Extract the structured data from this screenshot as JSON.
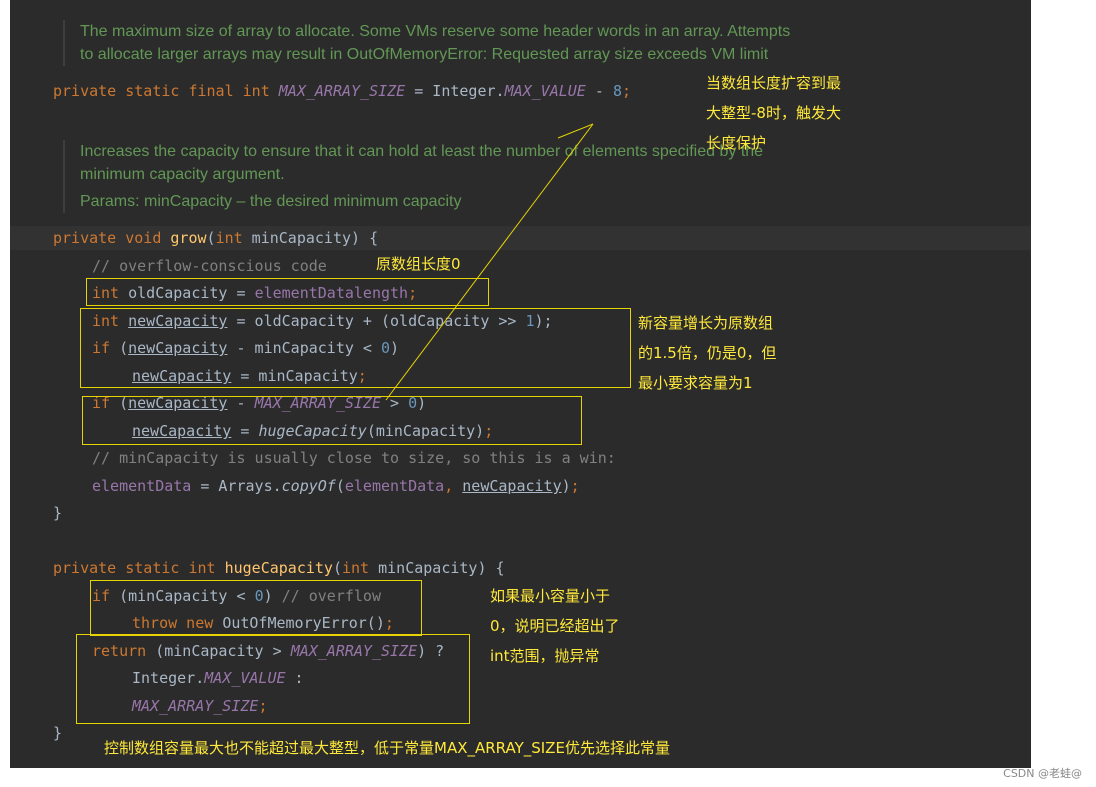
{
  "doc_comments": {
    "max_array_size": [
      "The maximum size of array to allocate. Some VMs reserve some header words in an array. Attempts",
      "to allocate larger arrays may result in OutOfMemoryError: Requested array size exceeds VM limit"
    ],
    "grow": [
      "Increases the capacity to ensure that it can hold at least the number of elements specified by the",
      "minimum capacity argument.",
      "Params: minCapacity – the desired minimum capacity"
    ]
  },
  "code": {
    "l1": {
      "a": "private static final int ",
      "b": "MAX_ARRAY_SIZE",
      "c": " = Integer.",
      "d": "MAX_VALUE",
      "e": " - ",
      "f": "8",
      ";": ";"
    },
    "l2": {
      "a": "private void ",
      "b": "grow",
      "c": "(",
      "d": "int",
      " e": "",
      "f": " minCapacity) {"
    },
    "l3": "// overflow-conscious code",
    "l4": {
      "a": "int",
      " b": "",
      "c": " oldCapacity = ",
      "d": "elementData",
      ".": ".",
      "e": "length",
      ";": ";"
    },
    "l5": {
      "a": "int ",
      "b": "newCapacity",
      "c": " = oldCapacity + (oldCapacity >> ",
      "d": "1",
      "e": ");"
    },
    "l6": {
      "a": "if",
      " b": "",
      "c": " (",
      "d": "newCapacity",
      "e": " - minCapacity < ",
      "f": "0",
      "g": ")"
    },
    "l7": {
      "a": "newCapacity",
      "b": " = minCapacity",
      ";": ";"
    },
    "l8": {
      "a": "if",
      "c": " (",
      "d": "newCapacity",
      "e": " - ",
      "f": "MAX_ARRAY_SIZE",
      "g": " > ",
      "h": "0",
      "i": ")"
    },
    "l9": {
      "a": "newCapacity",
      "b": " = ",
      "c": "hugeCapacity",
      "d": "(minCapacity)",
      ";": ";"
    },
    "l10": "// minCapacity is usually close to size, so this is a win:",
    "l11": {
      "a": "elementData",
      "b": " = Arrays.",
      "c": "copyOf",
      "d": "(",
      "e": "elementData",
      ",": ", ",
      "f": "newCapacity",
      "g": ")",
      ";": ";"
    },
    "l12": "}",
    "l13": {
      "a": "private static int ",
      "b": "hugeCapacity",
      "c": "(",
      "d": "int",
      "e": " minCapacity) {"
    },
    "l14": {
      "a": "if",
      "b": " (minCapacity < ",
      "c": "0",
      "d": ") ",
      "e": "// overflow"
    },
    "l15": {
      "a": "throw new ",
      "b": "OutOfMemoryError()",
      ";": ";"
    },
    "l16": {
      "a": "return",
      " b": "",
      "c": " (minCapacity > ",
      "d": "MAX_ARRAY_SIZE",
      "e": ") ?"
    },
    "l17": {
      "a": "Integer.",
      "b": "MAX_VALUE",
      "c": " :"
    },
    "l18": {
      "a": "MAX_ARRAY_SIZE",
      ";": ";"
    },
    "l19": "}"
  },
  "annotations": {
    "max_protect": "当数组长度扩容到最\n大整型-8时，触发大\n长度保护",
    "original_zero": "原数组长度0",
    "new_capacity": "新容量增长为原数组\n的1.5倍，仍是0，但\n最小要求容量为1",
    "overflow": "如果最小容量小于\n0，说明已经超出了\nint范围，抛异常",
    "bottom": "控制数组容量最大也不能超过最大整型，低于常量MAX_ARRAY_SIZE优先选择此常量"
  },
  "watermark": "CSDN @老蛙@",
  "colors": {
    "annotation": "#ffe93a",
    "keyword": "#cc7832",
    "doc": "#629755",
    "field": "#9876aa"
  }
}
